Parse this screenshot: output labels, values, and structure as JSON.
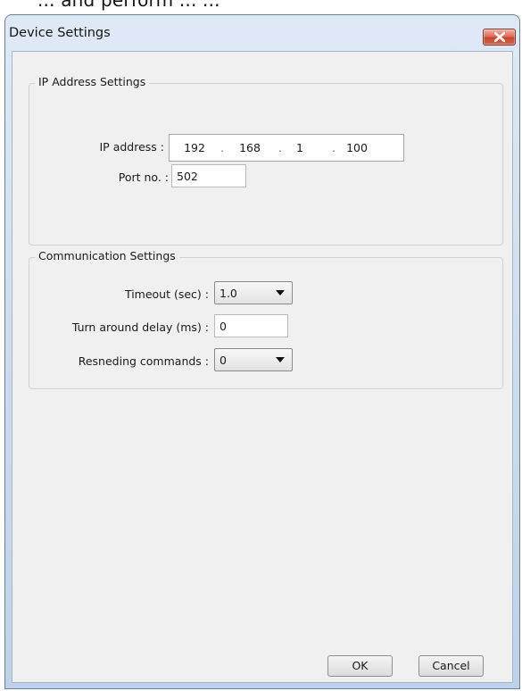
{
  "top_crop_text": "... and perform ... ...",
  "dialog": {
    "title": "Device Settings",
    "close_icon": "close-x-icon",
    "close_color": "#d05a44"
  },
  "ip_settings": {
    "legend": "IP Address Settings",
    "ip_label": "IP address :",
    "ip_octets": [
      "192",
      "168",
      "1",
      "100"
    ],
    "ip_separator": ".",
    "port_label": "Port no. :",
    "port_value": "502"
  },
  "communication_settings": {
    "legend": "Communication Settings",
    "timeout_label": "Timeout (sec) :",
    "timeout_value": "1.0",
    "turnaround_label": "Turn around delay (ms) :",
    "turnaround_value": "0",
    "resending_label": "Resneding commands :",
    "resending_value": "0"
  },
  "buttons": {
    "ok": "OK",
    "cancel": "Cancel"
  }
}
